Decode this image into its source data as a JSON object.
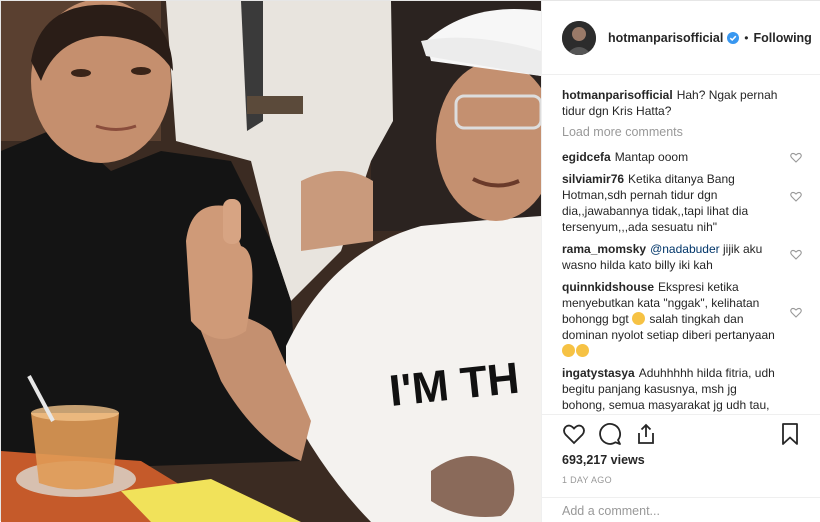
{
  "header": {
    "username": "hotmanparisofficial",
    "separator": "•",
    "follow_state": "Following"
  },
  "caption": {
    "username": "hotmanparisofficial",
    "text": "Hah? Ngak pernah tidur dgn Kris Hatta?"
  },
  "load_more": "Load more comments",
  "comments": [
    {
      "username": "egidcefa",
      "text": "Mantap ooom"
    },
    {
      "username": "silviamir76",
      "text": "Ketika ditanya Bang Hotman,sdh pernah tidur dgn dia,,jawabannya tidak,,tapi lihat dia tersenyum,,,ada sesuatu nih\""
    },
    {
      "username": "rama_momsky",
      "mention": "@nadabuder",
      "text": "jijik aku wasno hilda kato billy iki kah"
    },
    {
      "username": "quinnkidshouse",
      "text": "Ekspresi ketika menyebutkan kata \"nggak\", kelihatan bohongg bgt",
      "text2": "salah tingkah dan dominan nyolot setiap diberi pertanyaan"
    },
    {
      "username": "ingatystasya",
      "text": "Aduhhhhh hilda fitria, udh begitu panjang kasusnya, msh jg bohong, semua masyarakat jg udh tau, parahnya diajak lg..."
    }
  ],
  "stats": {
    "views": "693,217 views",
    "time_ago": "1 DAY AGO"
  },
  "add_comment_placeholder": "Add a comment...",
  "icons": {
    "like": "heart-icon",
    "comment": "comment-icon",
    "share": "share-icon",
    "save": "bookmark-icon",
    "verified": "verified-badge-icon"
  },
  "colors": {
    "text": "#262626",
    "muted": "#999999",
    "mention": "#003569",
    "verified": "#3897f0",
    "border": "#efefef"
  },
  "media": {
    "shirt_text": "I'M TH"
  }
}
